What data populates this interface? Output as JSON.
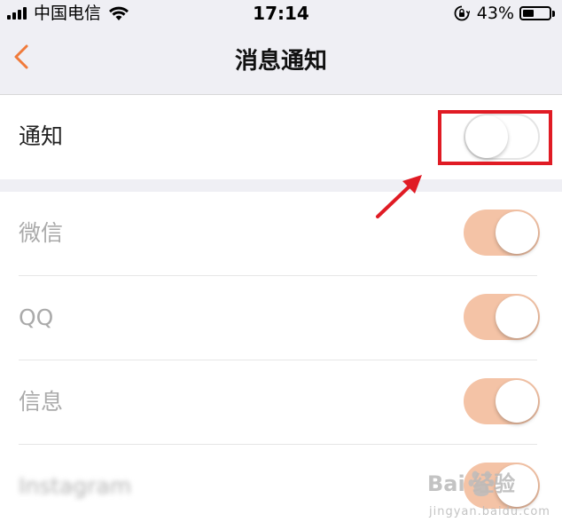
{
  "status_bar": {
    "carrier": "中国电信",
    "time": "17:14",
    "battery_percent": "43%",
    "battery_level": 0.43,
    "icons": [
      "signal-icon",
      "wifi-icon",
      "orientation-lock-icon",
      "battery-icon"
    ]
  },
  "nav": {
    "back_icon": "chevron-left-icon",
    "title": "消息通知"
  },
  "master_toggle": {
    "label": "通知",
    "enabled": false
  },
  "apps": [
    {
      "label": "微信",
      "enabled": true
    },
    {
      "label": "QQ",
      "enabled": true
    },
    {
      "label": "信息",
      "enabled": true
    },
    {
      "label": "Instagram",
      "enabled": true,
      "blurred": true
    }
  ],
  "annotation": {
    "box_color": "#e01b24",
    "arrow_color": "#e01b24"
  },
  "watermark": {
    "brand": "Bai 经验",
    "url": "jingyan.baidu.com"
  },
  "colors": {
    "accent": "#f07a3a",
    "switch_on_dimmed": "#f4c3a6",
    "background_gray": "#efeff4"
  }
}
